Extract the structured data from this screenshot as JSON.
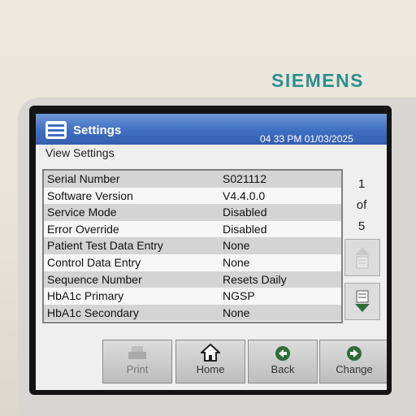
{
  "brand": "SIEMENS",
  "header": {
    "title": "Settings",
    "datetime": "04 33 PM  01/03/2025"
  },
  "subtitle": "View Settings",
  "settings": [
    {
      "label": "Serial Number",
      "value": "S021112"
    },
    {
      "label": "Software Version",
      "value": "V4.4.0.0"
    },
    {
      "label": "Service Mode",
      "value": "Disabled"
    },
    {
      "label": "Error Override",
      "value": "Disabled"
    },
    {
      "label": "Patient Test Data Entry",
      "value": "None"
    },
    {
      "label": "Control Data Entry",
      "value": "None"
    },
    {
      "label": "Sequence Number",
      "value": "Resets Daily"
    },
    {
      "label": "HbA1c Primary",
      "value": "NGSP"
    },
    {
      "label": "HbA1c Secondary",
      "value": "None"
    }
  ],
  "pager": {
    "current": "1",
    "of": "of",
    "total": "5"
  },
  "icons": {
    "menu": "menu-list-icon",
    "page_up": "page-up-icon",
    "page_down": "page-down-icon",
    "print": "printer-icon",
    "home": "house-icon",
    "back": "back-arrow-icon",
    "change": "forward-arrow-icon"
  },
  "buttons": {
    "print": "Print",
    "home": "Home",
    "back": "Back",
    "change": "Change"
  },
  "colors": {
    "brand": "#2f8f8b",
    "titlebar": "#3f6fc2",
    "accent_green": "#2f6c3a"
  }
}
